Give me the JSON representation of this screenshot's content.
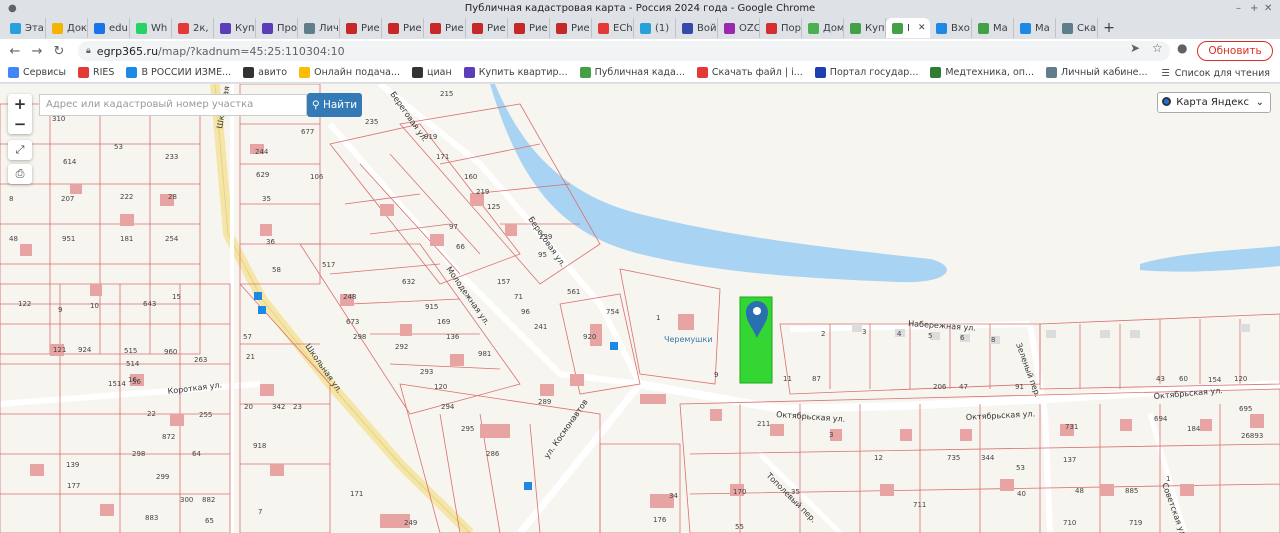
{
  "window": {
    "title": "Публичная кадастровая карта - Россия 2024 года - Google Chrome",
    "controls": [
      "–",
      "+",
      "✕"
    ]
  },
  "tabs": [
    {
      "label": "Эта",
      "color": "#2aa0da"
    },
    {
      "label": "Док",
      "color": "#f4b400"
    },
    {
      "label": "edu",
      "color": "#1a73e8"
    },
    {
      "label": "Wh",
      "color": "#25d366"
    },
    {
      "label": "2к,",
      "color": "#e53935"
    },
    {
      "label": "Куп",
      "color": "#5c3db8"
    },
    {
      "label": "Про",
      "color": "#5c3db8"
    },
    {
      "label": "Лич",
      "color": "#607d8b"
    },
    {
      "label": "Рие",
      "color": "#c62828"
    },
    {
      "label": "Рие",
      "color": "#c62828"
    },
    {
      "label": "Рие",
      "color": "#c62828"
    },
    {
      "label": "Рие",
      "color": "#c62828"
    },
    {
      "label": "Рие",
      "color": "#c62828"
    },
    {
      "label": "Рие",
      "color": "#c62828"
    },
    {
      "label": "ECh",
      "color": "#e53935"
    },
    {
      "label": "(1)",
      "color": "#2aa0da"
    },
    {
      "label": "Вой",
      "color": "#3949ab"
    },
    {
      "label": "OZC",
      "color": "#9c27b0"
    },
    {
      "label": "Пор",
      "color": "#d32f2f"
    },
    {
      "label": "Дом",
      "color": "#4caf50"
    },
    {
      "label": "Куп",
      "color": "#43a047"
    },
    {
      "label": "I",
      "color": "#43a047",
      "active": true
    },
    {
      "label": "Вхо",
      "color": "#1e88e5"
    },
    {
      "label": "Ма",
      "color": "#43a047"
    },
    {
      "label": "Ма",
      "color": "#1e88e5"
    },
    {
      "label": "Ска",
      "color": "#607d8b"
    }
  ],
  "address": {
    "host": "egrp365.ru",
    "path": "/map/?kadnum=45:25:110304:10",
    "update_label": "Обновить"
  },
  "bookmarks": [
    {
      "label": "Сервисы",
      "color": "#4285f4"
    },
    {
      "label": "RIES",
      "color": "#e53935"
    },
    {
      "label": "В РОССИИ ИЗМЕ...",
      "color": "#1e88e5"
    },
    {
      "label": "авито",
      "color": "#333333"
    },
    {
      "label": "Онлайн подача...",
      "color": "#fbbc04"
    },
    {
      "label": "циан",
      "color": "#333333"
    },
    {
      "label": "Купить квартир...",
      "color": "#5c3db8"
    },
    {
      "label": "Публичная када...",
      "color": "#43a047"
    },
    {
      "label": "Скачать файл | i...",
      "color": "#e53935"
    },
    {
      "label": "Портал государ...",
      "color": "#1e40af"
    },
    {
      "label": "Медтехника, оп...",
      "color": "#2e7d32"
    },
    {
      "label": "Личный кабине...",
      "color": "#607d8b"
    }
  ],
  "reading_list": "Список для чтения",
  "map": {
    "search_placeholder": "Адрес или кадастровый номер участка",
    "search_button": "Найти",
    "layer": "Карта Яндекс",
    "streets": [
      "Школьная ул.",
      "Школьная ул.",
      "Молодежная ул.",
      "Береговая ул.",
      "Береговая ул.",
      "ул. Космонавтов",
      "Короткая ул.",
      "Набережная ул.",
      "Октябрьская ул.",
      "Октябрьская ул.",
      "Октябрьская ул.",
      "Зеленый пер.",
      "Тополевый пер.",
      "Советская ул."
    ],
    "poi": "Черемушки",
    "selected_parcel": "45:25:110304:10",
    "parcel_numbers": [
      "215",
      "310",
      "677",
      "244",
      "629",
      "106",
      "614",
      "53",
      "233",
      "207",
      "222",
      "28",
      "951",
      "181",
      "254",
      "48",
      "8",
      "35",
      "36",
      "235",
      "919",
      "171",
      "160",
      "219",
      "125",
      "97",
      "66",
      "632",
      "915",
      "169",
      "136",
      "981",
      "157",
      "71",
      "96",
      "241",
      "239",
      "95",
      "58",
      "517",
      "248",
      "673",
      "298",
      "292",
      "293",
      "120",
      "294",
      "295",
      "286",
      "289",
      "561",
      "920",
      "754",
      "122",
      "9",
      "10",
      "643",
      "15",
      "121",
      "924",
      "515",
      "514",
      "16",
      "960",
      "263",
      "1514",
      "56",
      "57",
      "21",
      "20",
      "342",
      "23",
      "22",
      "255",
      "872",
      "298",
      "64",
      "139",
      "177",
      "299",
      "300",
      "882",
      "883",
      "65",
      "171",
      "249",
      "918",
      "7",
      "1",
      "2",
      "3",
      "4",
      "5",
      "6",
      "8",
      "9",
      "11",
      "87",
      "206",
      "47",
      "91",
      "43",
      "60",
      "154",
      "120",
      "34",
      "694",
      "695",
      "26893",
      "211",
      "1",
      "3",
      "12",
      "735",
      "344",
      "53",
      "137",
      "48",
      "885",
      "719",
      "710",
      "40",
      "711",
      "35",
      "170",
      "731",
      "184",
      "176",
      "55",
      "4",
      "20",
      "3",
      "1"
    ]
  }
}
